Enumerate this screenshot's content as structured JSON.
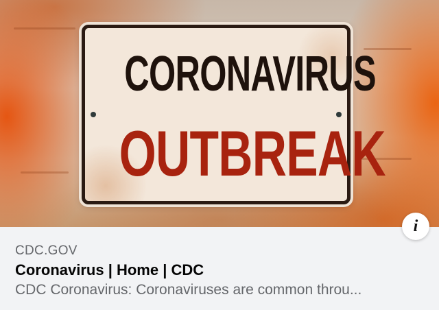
{
  "link_preview": {
    "image": {
      "sign_line_1": "CORONAVIRUS",
      "sign_line_2": "OUTBREAK",
      "sign_line_1_color": "#1e120c",
      "sign_line_2_color": "#a8230f"
    },
    "info_button": {
      "icon": "info-icon",
      "glyph": "i"
    },
    "domain": "CDC.GOV",
    "title": "Coronavirus | Home | CDC",
    "description": "CDC Coronavirus: Coronaviruses are common throu..."
  }
}
